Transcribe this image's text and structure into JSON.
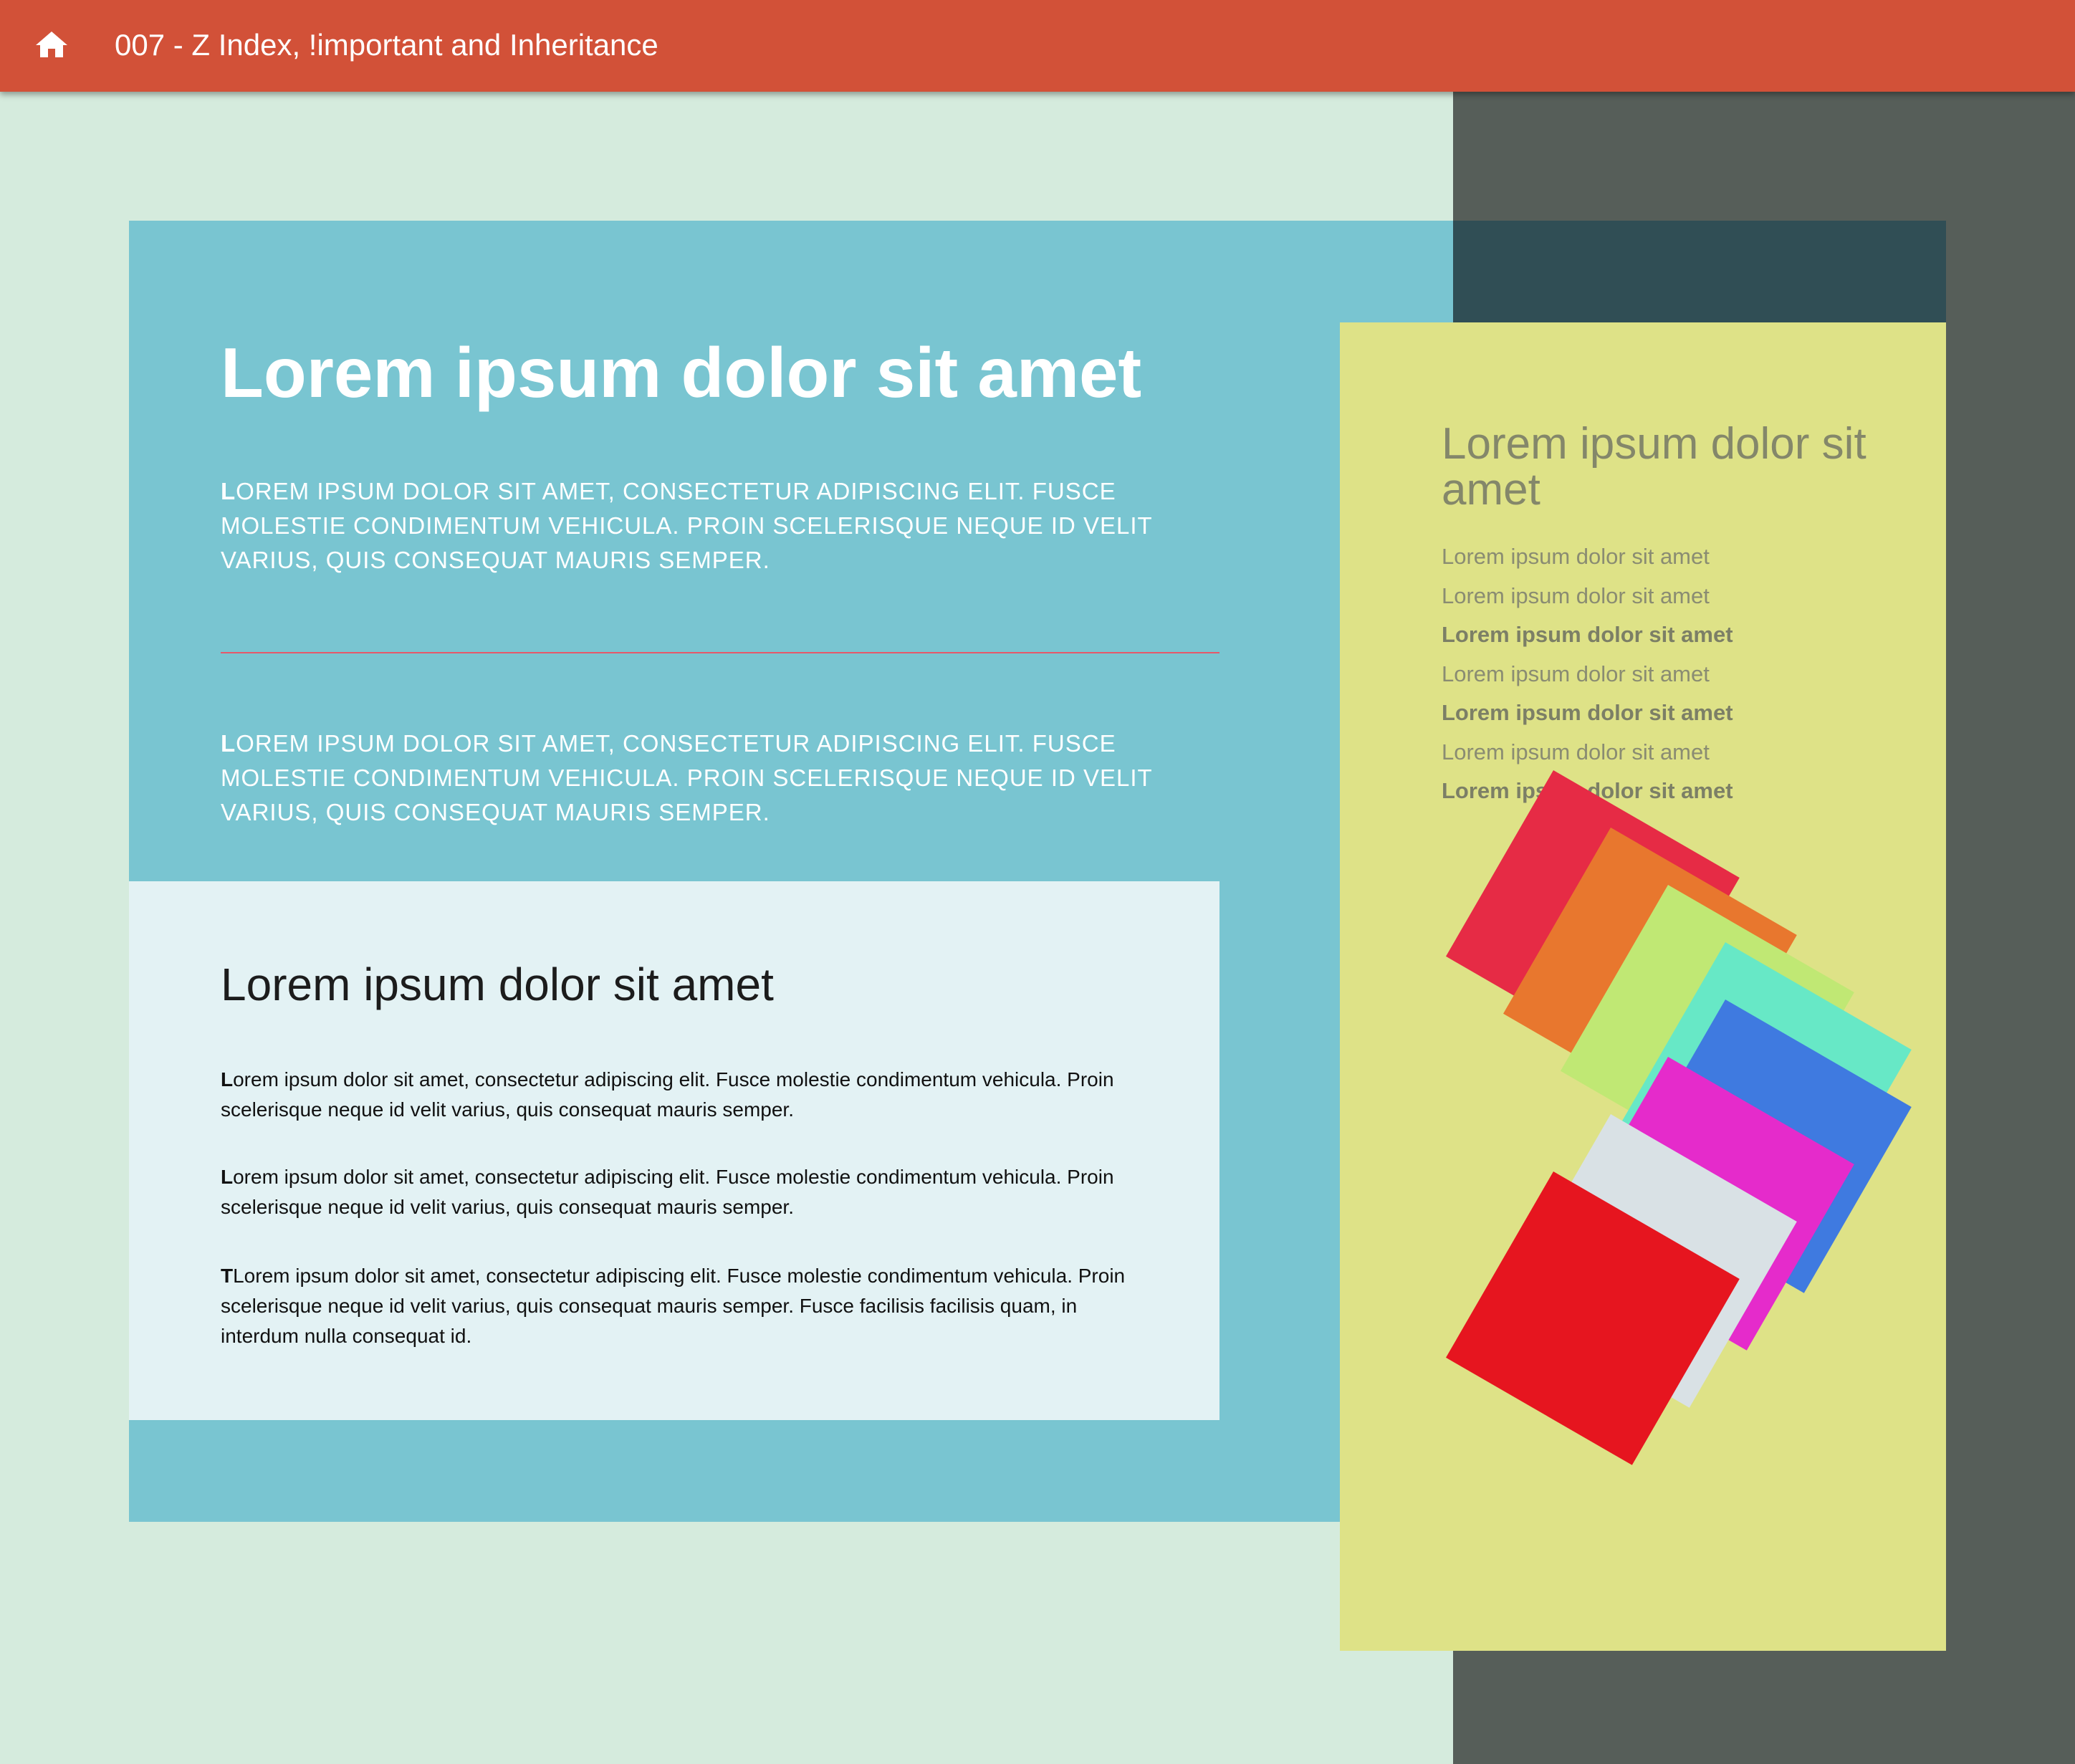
{
  "header": {
    "title": "007 - Z Index, !important and Inheritance",
    "home_icon": "home-icon"
  },
  "hero": {
    "title": "Lorem ipsum dolor sit amet",
    "paragraph_1": "Lorem ipsum dolor sit amet, consectetur adipiscing elit. Fusce molestie condimentum vehicula. Proin scelerisque neque id velit varius, quis consequat mauris semper.",
    "paragraph_2": "Lorem ipsum dolor sit amet, consectetur adipiscing elit. Fusce molestie condimentum vehicula. Proin scelerisque neque id velit varius, quis consequat mauris semper."
  },
  "card": {
    "title": "Lorem ipsum dolor sit amet",
    "paragraphs": [
      "Lorem ipsum dolor sit amet, consectetur adipiscing elit. Fusce molestie condimentum vehicula. Proin scelerisque neque id velit varius, quis consequat mauris semper.",
      "Lorem ipsum dolor sit amet, consectetur adipiscing elit. Fusce molestie condimentum vehicula. Proin scelerisque neque id velit varius, quis consequat mauris semper.",
      "TLorem ipsum dolor sit amet, consectetur adipiscing elit. Fusce molestie condimentum vehicula. Proin scelerisque neque id velit varius, quis consequat mauris semper. Fusce facilisis facilisis quam, in interdum nulla consequat id."
    ]
  },
  "sidebar": {
    "title": "Lorem ipsum dolor sit amet",
    "items": [
      {
        "label": "Lorem ipsum dolor sit amet",
        "bold": false
      },
      {
        "label": "Lorem ipsum dolor sit amet",
        "bold": false
      },
      {
        "label": "Lorem ipsum dolor sit amet",
        "bold": true
      },
      {
        "label": "Lorem ipsum dolor sit amet",
        "bold": false
      },
      {
        "label": "Lorem ipsum dolor sit amet",
        "bold": true
      },
      {
        "label": "Lorem ipsum dolor sit amet",
        "bold": false
      },
      {
        "label": "Lorem ipsum dolor sit amet",
        "bold": true
      }
    ]
  },
  "squares": {
    "colors": [
      "#e62b45",
      "#e8772e",
      "#c0e874",
      "#67e8c6",
      "#3f7ae0",
      "#e52bcb",
      "#d9e1e5",
      "#e6151f"
    ]
  },
  "colors": {
    "header": "#d25138",
    "background": "#d5ebdd",
    "dark_column": "#565e59",
    "blue_panel": "#79c5d1",
    "light_card": "#e3f2f4",
    "yellow_panel": "#dee287",
    "rule": "#e6586a"
  }
}
